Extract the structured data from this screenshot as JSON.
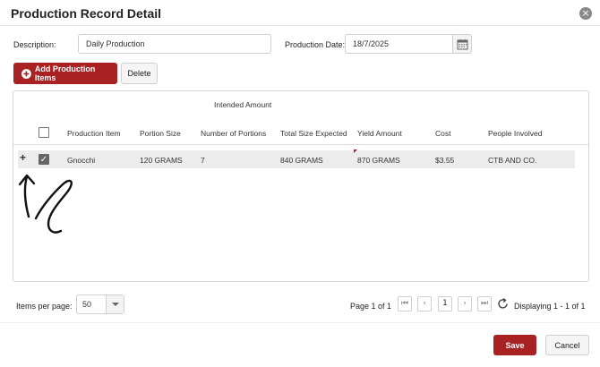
{
  "dialog": {
    "title": "Production Record Detail",
    "close_glyph": "×"
  },
  "form": {
    "description_label": "Description:",
    "description_value": "Daily Production",
    "date_label": "Production Date:",
    "date_value": "18/7/2025"
  },
  "toolbar": {
    "add_label": "Add Production Items",
    "delete_label": "Delete"
  },
  "table": {
    "group_header": "Intended Amount",
    "columns": [
      "Production Item",
      "Portion Size",
      "Number of Portions",
      "Total Size Expected",
      "Yield Amount",
      "Cost",
      "People Involved"
    ],
    "rows": [
      {
        "expand": "+",
        "checked": true,
        "item": "Gnocchi",
        "portion_size": "120 GRAMS",
        "portions": "7",
        "total_expected": "840 GRAMS",
        "yield": "870 GRAMS",
        "cost": "$3.55",
        "people": "CTB AND CO."
      }
    ]
  },
  "pagination": {
    "items_per_page_label": "Items per page:",
    "items_per_page_value": "50",
    "page_text": "Page 1 of 1",
    "current_page": "1",
    "display_text": "Displaying 1 - 1 of 1"
  },
  "footer": {
    "save_label": "Save",
    "cancel_label": "Cancel"
  },
  "colors": {
    "accent": "#a82123",
    "annotation": "#111111"
  },
  "icons": [
    "close-icon",
    "calendar-icon",
    "plus-circle-icon",
    "expand-icon",
    "checkbox-icon",
    "dropdown-caret-icon",
    "first-page-icon",
    "prev-page-icon",
    "next-page-icon",
    "last-page-icon",
    "refresh-icon"
  ]
}
